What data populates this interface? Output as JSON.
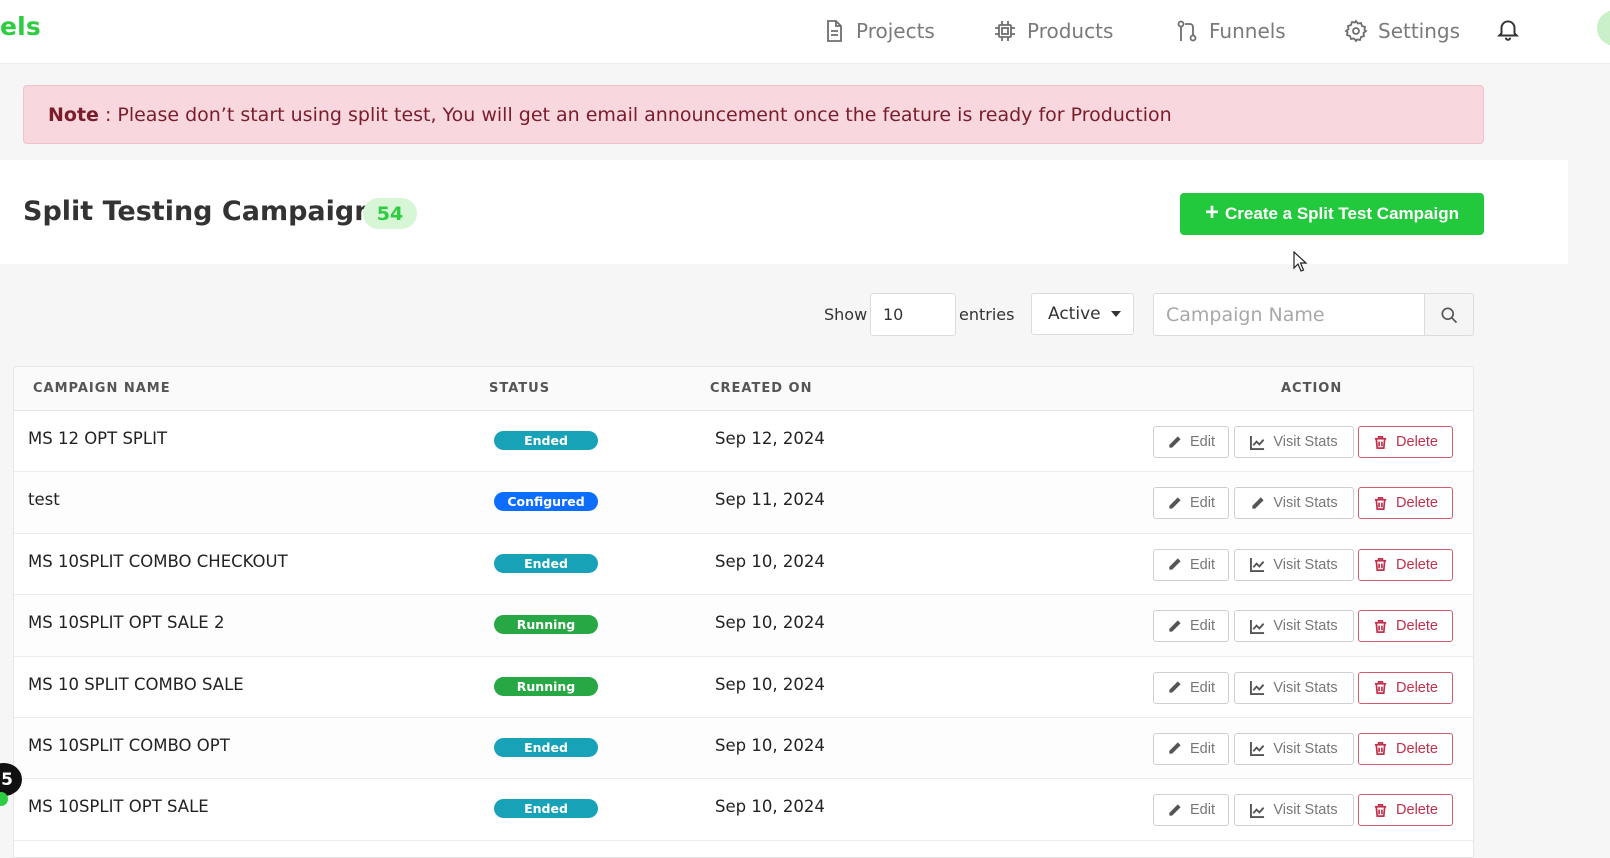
{
  "brand": {
    "text": "els"
  },
  "nav": {
    "items": [
      {
        "label": "Projects",
        "icon": "document-icon"
      },
      {
        "label": "Products",
        "icon": "chip-icon"
      },
      {
        "label": "Funnels",
        "icon": "branch-icon"
      },
      {
        "label": "Settings",
        "icon": "gear-icon"
      }
    ]
  },
  "note": {
    "label": "Note",
    "text": ": Please don’t start using split test, You will get an email announcement once the feature is ready for Production"
  },
  "page": {
    "title": "Split Testing Campaigns",
    "count": "54",
    "create_label": "Create a Split Test Campaign"
  },
  "filters": {
    "show_label": "Show",
    "entries_value": "10",
    "entries_label": "entries",
    "status_value": "Active",
    "search_placeholder": "Campaign Name"
  },
  "table": {
    "headers": [
      "CAMPAIGN NAME",
      "STATUS",
      "CREATED ON",
      "ACTION"
    ],
    "actions": {
      "edit": "Edit",
      "stats": "Visit Stats",
      "delete": "Delete"
    },
    "rows": [
      {
        "name": "MS 12 OPT SPLIT",
        "status": "Ended",
        "created": "Sep 12, 2024"
      },
      {
        "name": "test",
        "status": "Configured",
        "created": "Sep 11, 2024"
      },
      {
        "name": "MS 10SPLIT COMBO CHECKOUT",
        "status": "Ended",
        "created": "Sep 10, 2024"
      },
      {
        "name": "MS 10SPLIT OPT SALE 2",
        "status": "Running",
        "created": "Sep 10, 2024"
      },
      {
        "name": "MS 10 SPLIT COMBO SALE",
        "status": "Running",
        "created": "Sep 10, 2024"
      },
      {
        "name": "MS 10SPLIT COMBO OPT",
        "status": "Ended",
        "created": "Sep 10, 2024"
      },
      {
        "name": "MS 10SPLIT OPT SALE",
        "status": "Ended",
        "created": "Sep 10, 2024"
      }
    ]
  },
  "status_colors": {
    "Ended": "#17a2b8",
    "Configured": "#0d6efd",
    "Running": "#28a745"
  },
  "side_badge": "5"
}
